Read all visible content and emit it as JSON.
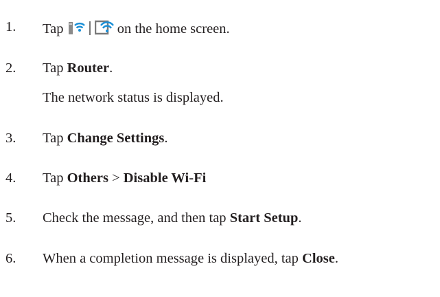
{
  "steps": [
    {
      "num": "1.",
      "pre": "Tap",
      "post": "on the home screen."
    },
    {
      "num": "2.",
      "pre": "Tap ",
      "bold": "Router",
      "post": ".",
      "note": "The network status is displayed."
    },
    {
      "num": "3.",
      "pre": "Tap ",
      "bold": "Change Settings",
      "post": "."
    },
    {
      "num": "4.",
      "pre": "Tap ",
      "bold": "Others",
      "mid": " > ",
      "bold2": "Disable Wi-Fi"
    },
    {
      "num": "5.",
      "pre": "Check the message, and then tap ",
      "bold": "Start Setup",
      "post": "."
    },
    {
      "num": "6.",
      "pre": "When a completion message is displayed, tap ",
      "bold": "Close",
      "post": "."
    }
  ],
  "icons": {
    "first": "wifi-router-icon",
    "second": "wifi-direct-icon",
    "color_signal": "#1a8fd6",
    "color_device": "#7a7a7a"
  }
}
